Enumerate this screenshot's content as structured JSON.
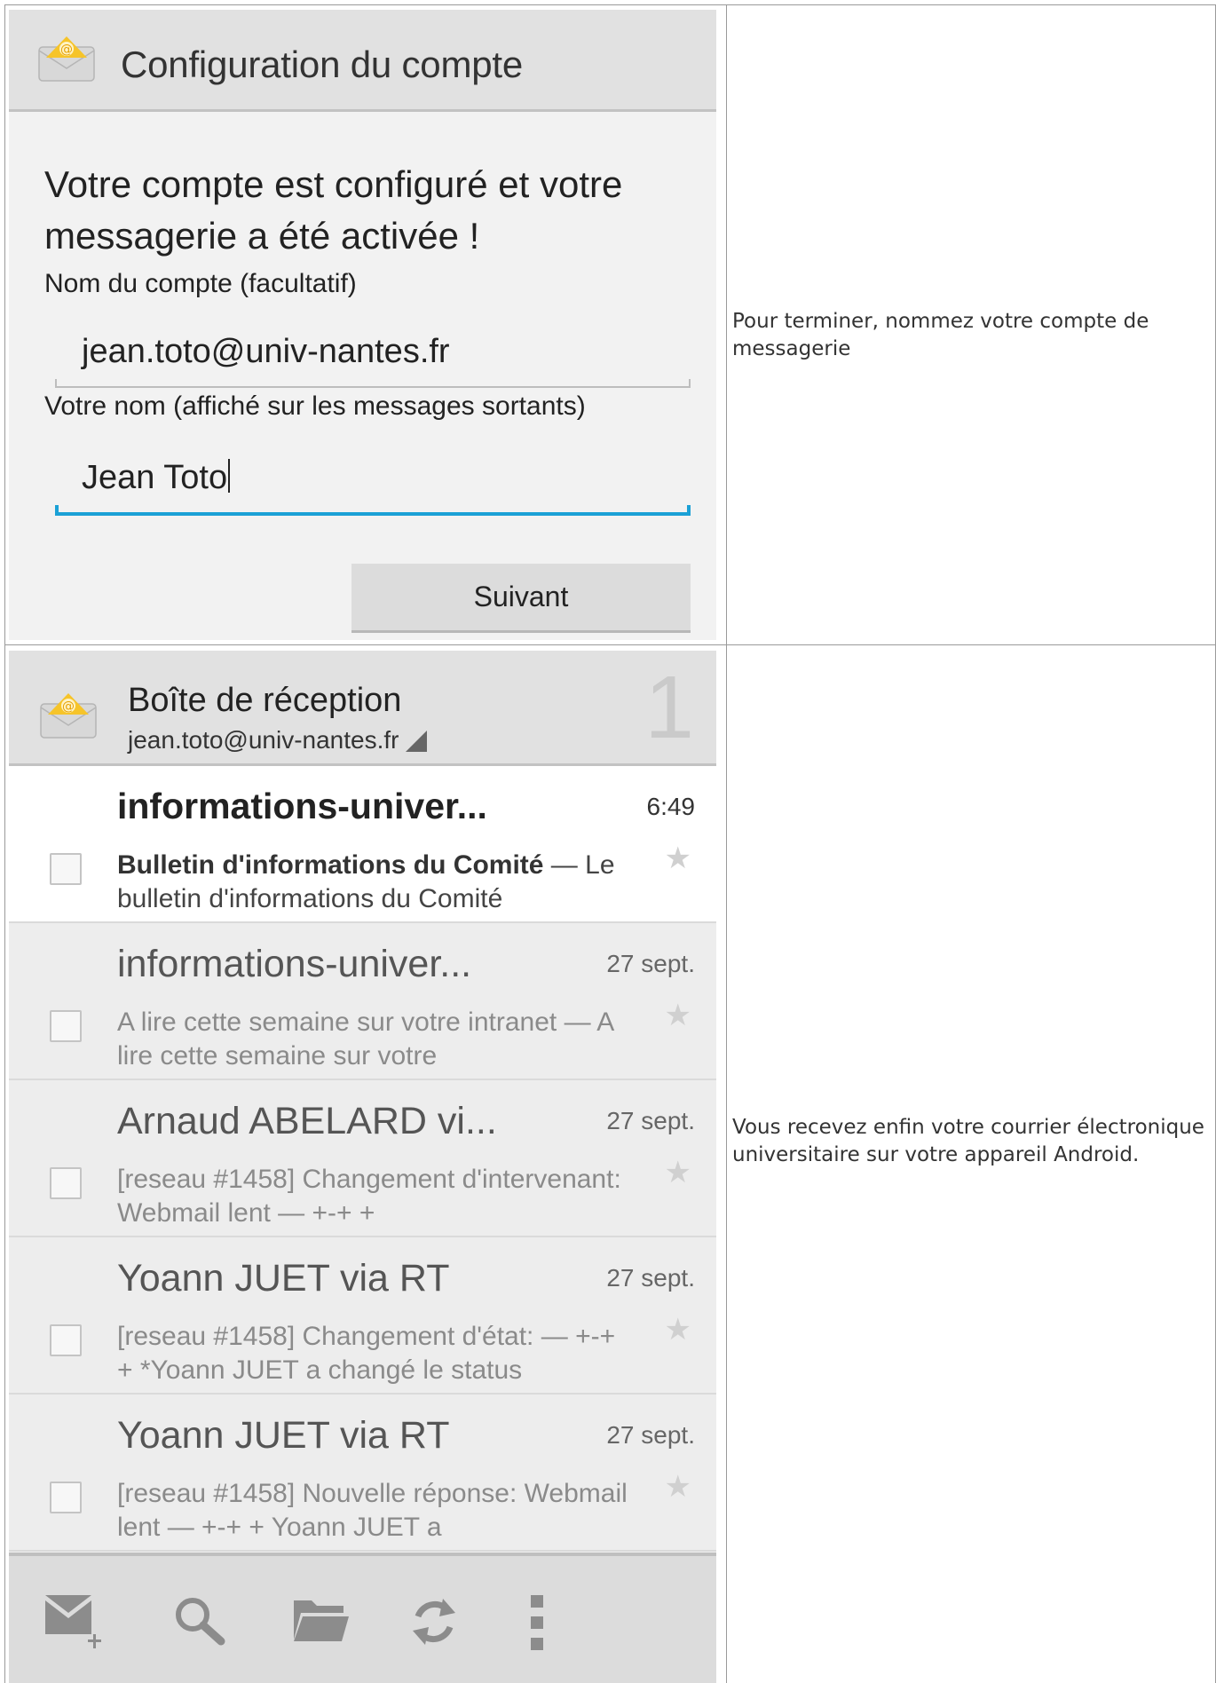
{
  "setup_screen": {
    "title": "Configuration du compte",
    "heading": "Votre compte est configuré et votre messagerie a été activée !",
    "account_name_label": "Nom du compte (facultatif)",
    "account_name_value": "jean.toto@univ-nantes.fr",
    "your_name_label": "Votre nom (affiché sur les messages sortants)",
    "your_name_value": "Jean Toto",
    "next_button": "Suivant"
  },
  "caption_1": "Pour terminer, nommez votre compte de messagerie",
  "inbox_screen": {
    "title": "Boîte de réception",
    "account": "jean.toto@univ-nantes.fr",
    "unread_count": "1",
    "messages": [
      {
        "sender": "informations-univer...",
        "date": "6:49",
        "subject": "Bulletin d'informations du Comité",
        "preview": " — Le bulletin d'informations du Comité",
        "unread": true
      },
      {
        "sender": "informations-univer...",
        "date": "27 sept.",
        "snippet": "A lire cette semaine sur votre intranet — A lire cette semaine sur votre",
        "unread": false
      },
      {
        "sender": "Arnaud ABELARD vi...",
        "date": "27 sept.",
        "snippet": "[reseau #1458] Changement d'intervenant: Webmail lent — +-+ +",
        "unread": false
      },
      {
        "sender": "Yoann JUET via RT",
        "date": "27 sept.",
        "snippet": "[reseau #1458] Changement d'état: — +-+ + *Yoann JUET a changé le status",
        "unread": false
      },
      {
        "sender": "Yoann JUET via RT",
        "date": "27 sept.",
        "snippet": "[reseau #1458] Nouvelle réponse: Webmail lent — +-+ + Yoann JUET a",
        "unread": false
      }
    ],
    "toolbar_icons": [
      "compose-icon",
      "search-icon",
      "folder-icon",
      "refresh-icon",
      "overflow-menu-icon"
    ]
  },
  "caption_2": "Vous recevez enfin votre courrier électronique universitaire sur votre appareil Android.",
  "colors": {
    "accent": "#1ba1d6",
    "action_bar": "#e1e1e1",
    "envelope": "#f6c42a"
  }
}
